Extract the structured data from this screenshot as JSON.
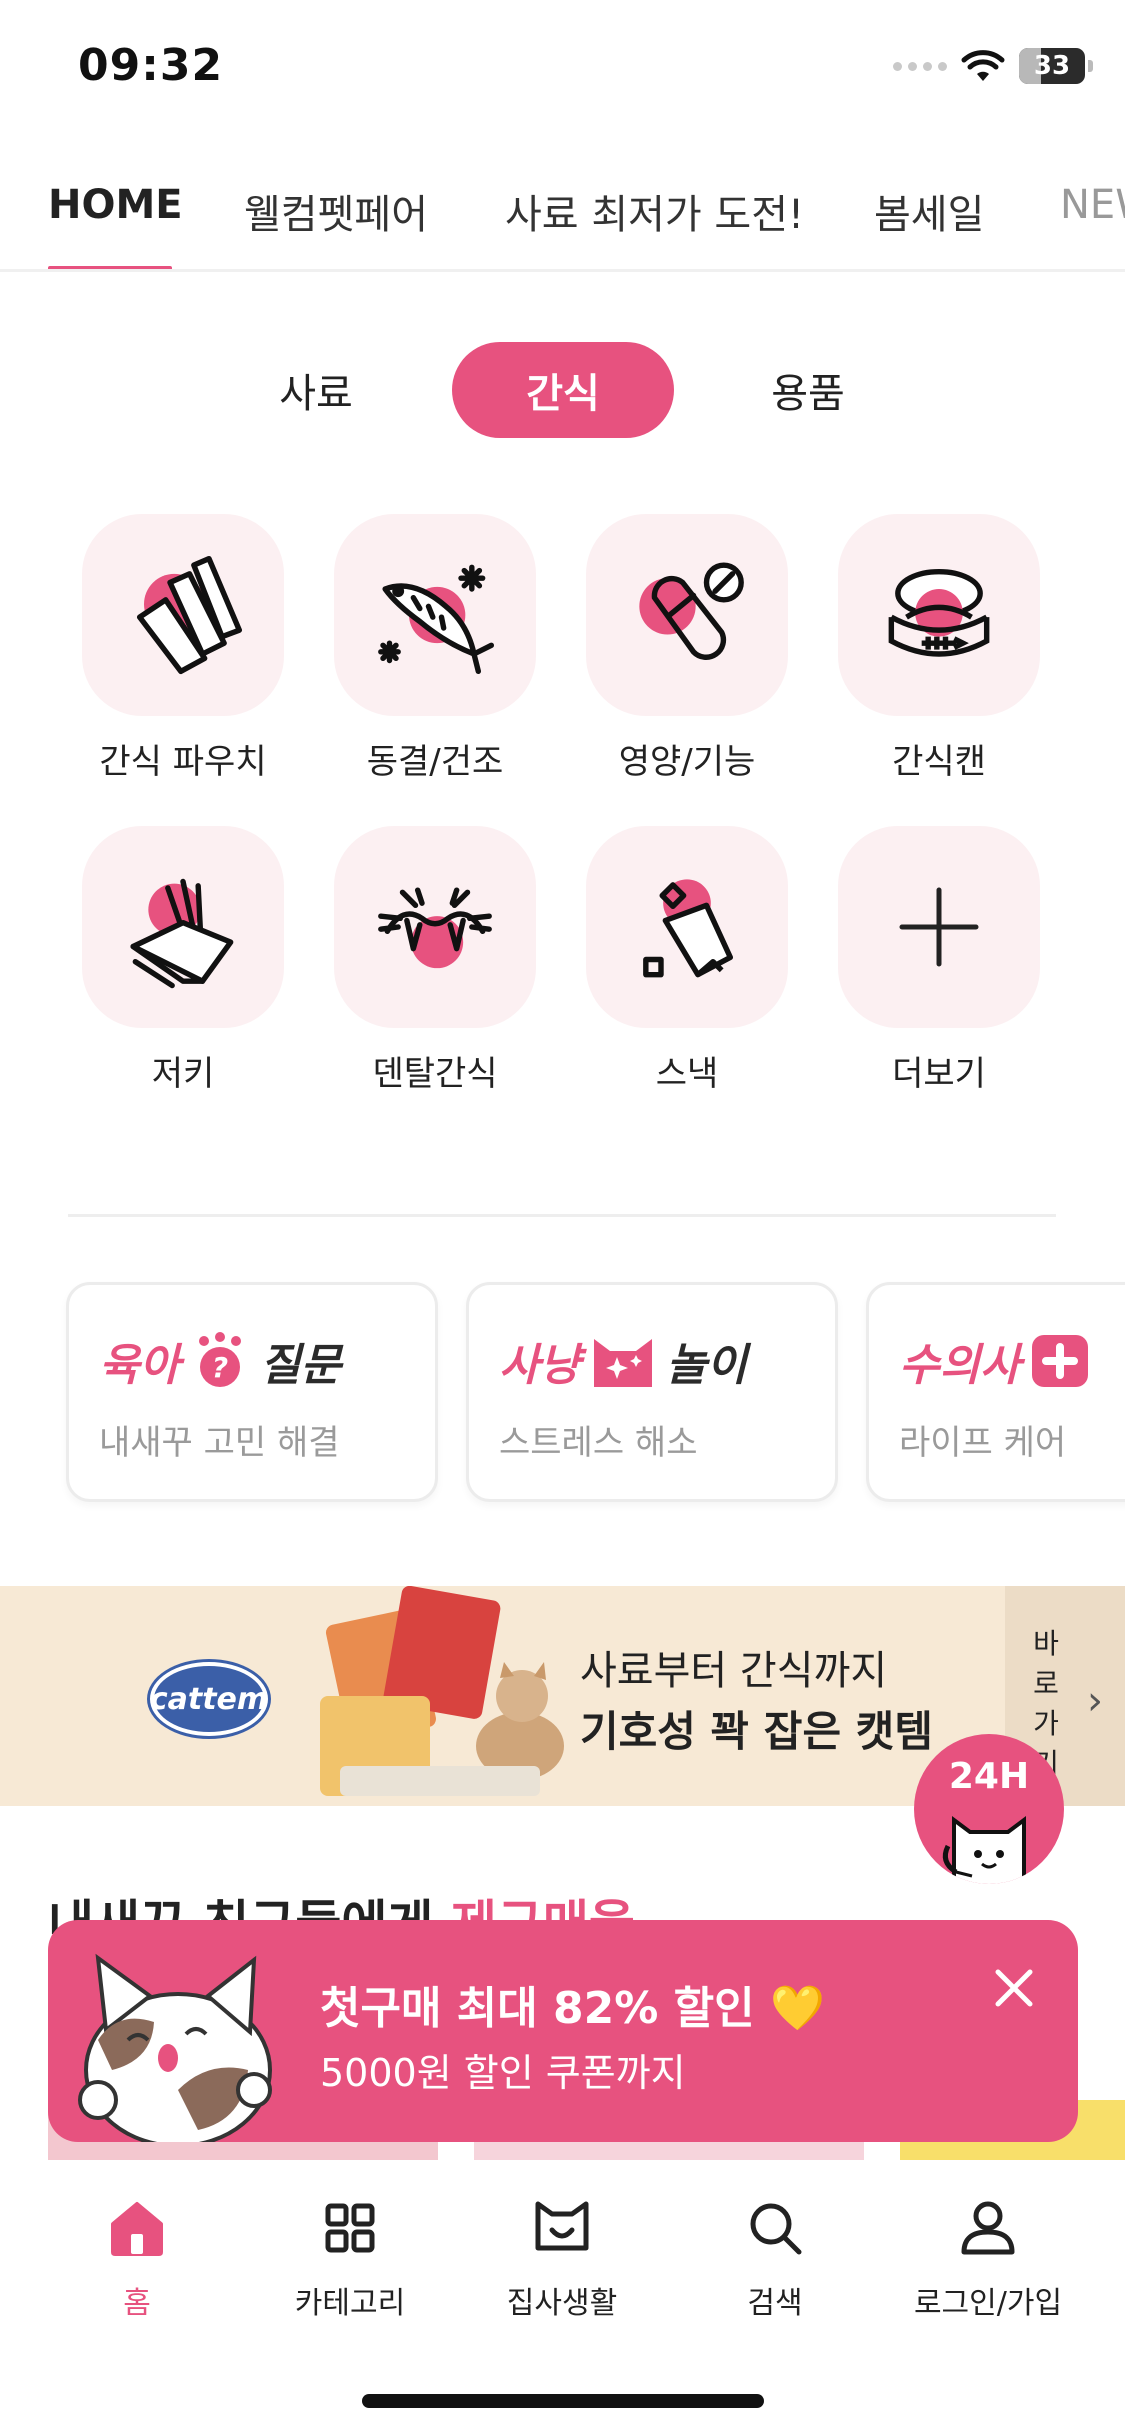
{
  "status_bar": {
    "time": "09:32",
    "battery_percent": "33",
    "battery_level": 0.33
  },
  "top_tabs": [
    {
      "label": "HOME",
      "active": true
    },
    {
      "label": "웰컴펫페어",
      "active": false
    },
    {
      "label": "사료 최저가 도전!",
      "active": false
    },
    {
      "label": "봄세일",
      "active": false
    },
    {
      "label": "NEW",
      "active": false
    }
  ],
  "segments": [
    {
      "label": "사료",
      "active": false
    },
    {
      "label": "간식",
      "active": true
    },
    {
      "label": "용품",
      "active": false
    }
  ],
  "categories": [
    {
      "label": "간식 파우치",
      "icon": "snack-pouch-icon"
    },
    {
      "label": "동결/건조",
      "icon": "freeze-dried-fish-icon"
    },
    {
      "label": "영양/기능",
      "icon": "supplement-pill-icon"
    },
    {
      "label": "간식캔",
      "icon": "snack-can-icon"
    },
    {
      "label": "저키",
      "icon": "jerky-icon"
    },
    {
      "label": "덴탈간식",
      "icon": "dental-snack-icon"
    },
    {
      "label": "스낵",
      "icon": "snack-bag-icon"
    },
    {
      "label": "더보기",
      "icon": "plus-icon"
    }
  ],
  "community_cards": [
    {
      "title_a": "육아",
      "title_b": "질문",
      "subtitle": "내새꾸 고민 해결",
      "icon": "question-paw-icon"
    },
    {
      "title_a": "사냥",
      "title_b": "놀이",
      "subtitle": "스트레스 해소",
      "icon": "cat-sparkle-icon"
    },
    {
      "title_a": "수의사",
      "title_b": "",
      "subtitle": "라이프 케어",
      "icon": "medical-plus-icon"
    }
  ],
  "banner": {
    "brand": "cattem",
    "line1": "사료부터 간식까지",
    "line2": "기호성 꽉 잡은 캣템",
    "side_label": "바로가기"
  },
  "fab_24h": {
    "label": "24H"
  },
  "section": {
    "title_prefix": "내새꾸 친구들에게 ",
    "title_accent": "제구매율"
  },
  "toast": {
    "line1": "첫구매 최대 82% 할인 💛",
    "line2": "5000원 할인 쿠폰까지"
  },
  "bottom_nav": [
    {
      "label": "홈",
      "icon": "home-icon",
      "active": true
    },
    {
      "label": "카테고리",
      "icon": "category-grid-icon",
      "active": false
    },
    {
      "label": "집사생활",
      "icon": "cat-face-icon",
      "active": false
    },
    {
      "label": "검색",
      "icon": "search-icon",
      "active": false
    },
    {
      "label": "로그인/가입",
      "icon": "user-icon",
      "active": false
    }
  ],
  "colors": {
    "accent": "#e7527f",
    "tile_bg": "#fcf0f2",
    "banner_bg": "#f7e9d5"
  }
}
